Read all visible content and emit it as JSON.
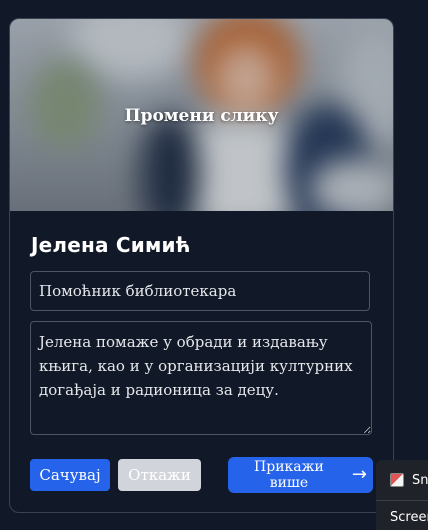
{
  "card": {
    "change_photo_label": "Промени слику",
    "name": "Јелена Симић",
    "title_field": {
      "value": "Помоћник библиотекара"
    },
    "bio_field": {
      "value": "Јелена помаже у обради и издавању књига, као и у организацији културних догађаја и радионица за децу."
    },
    "buttons": {
      "save": "Сачувај",
      "cancel": "Откажи",
      "show_more": "Прикажи више",
      "show_more_arrow": "→"
    }
  },
  "context_popup": {
    "item1": "Sn",
    "item2": "Screen"
  },
  "colors": {
    "background": "#111827",
    "primary": "#2563eb",
    "cancel": "#d1d5db"
  }
}
